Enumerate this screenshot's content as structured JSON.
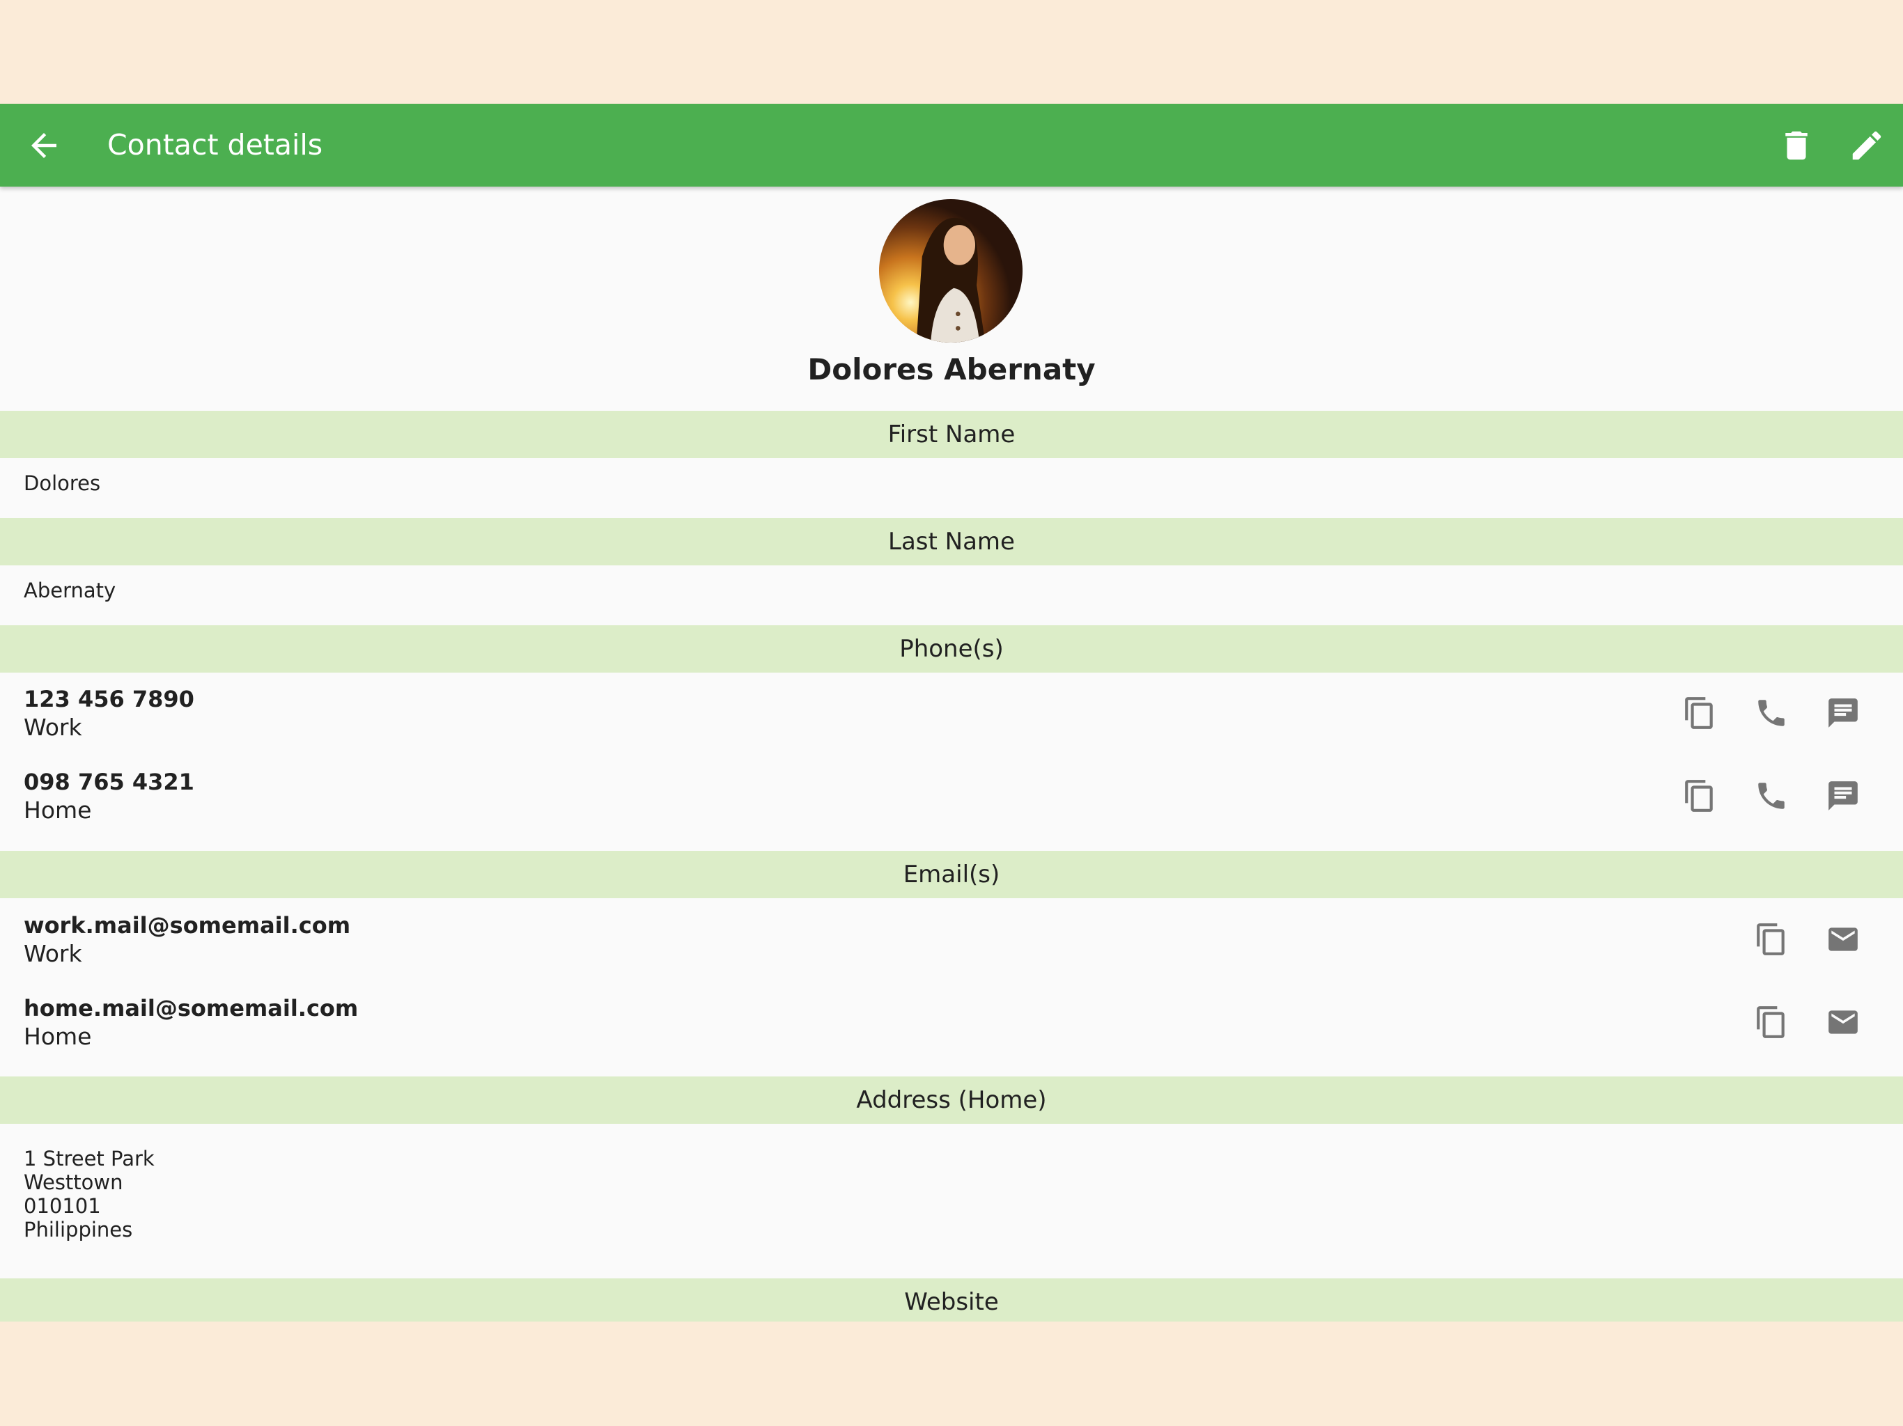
{
  "appbar": {
    "title": "Contact details"
  },
  "contact": {
    "display_name": "Dolores Abernaty"
  },
  "sections": {
    "first_name": {
      "label": "First Name",
      "value": "Dolores"
    },
    "last_name": {
      "label": "Last Name",
      "value": "Abernaty"
    },
    "phones": {
      "label": "Phone(s)",
      "items": [
        {
          "number": "123 456 7890",
          "type": "Work"
        },
        {
          "number": "098 765 4321",
          "type": "Home"
        }
      ]
    },
    "emails": {
      "label": "Email(s)",
      "items": [
        {
          "address": "work.mail@somemail.com",
          "type": "Work"
        },
        {
          "address": "home.mail@somemail.com",
          "type": "Home"
        }
      ]
    },
    "address": {
      "label": "Address (Home)",
      "lines": [
        "1 Street Park",
        "Westtown",
        "010101",
        "Philippines"
      ]
    },
    "website": {
      "label": "Website"
    }
  },
  "icons": {
    "back": "arrow-back-icon",
    "delete": "delete-icon",
    "edit": "edit-icon",
    "copy": "copy-icon",
    "call": "phone-icon",
    "message": "message-icon",
    "email": "email-icon"
  },
  "colors": {
    "appbar": "#4caf50",
    "section_header": "#dcedc8",
    "background": "#fafafa",
    "outer": "#fbebd8",
    "action_icon": "#757575"
  }
}
